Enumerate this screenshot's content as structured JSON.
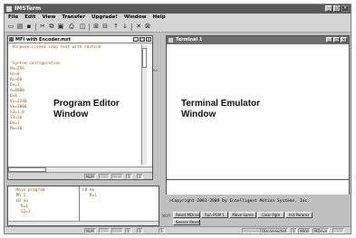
{
  "app": {
    "title": "IMSTerm"
  },
  "menu": [
    "File",
    "Edit",
    "View",
    "Transfer",
    "Upgrade!",
    "Window",
    "Help"
  ],
  "toolbar": {
    "icons": [
      "new-icon",
      "open-icon",
      "save-icon",
      "cut-icon",
      "copy-icon",
      "paste-icon",
      "print-icon",
      "properties-icon",
      "connect-icon",
      "disconnect-icon",
      "upload-icon",
      "download-icon",
      "close-x-icon"
    ]
  },
  "editor": {
    "title": "MFI with Encoder.mxt",
    "label": "Program Editor\nWindow",
    "code": "'Purpose:Closed loop test with routine\n\n\n'System configuration\nMs=256\nHc=0\nRc=60\nEe=1\nA=4000\nD=A\nVi=2240\nVm=3000\nS1=1,0\nS3=16\nDe=1\nMu=16",
    "status": [
      "NLM",
      "CAP",
      "NUM",
      "1",
      "1"
    ]
  },
  "immediate": {
    "left_code": "'Main program\n PR 1\n LB aa\n   R=1\n   S2=1",
    "right_code": "LB Hu\n   R=1"
  },
  "stray_text": "oo",
  "terminal": {
    "title": "Terminal 1",
    "label": "Terminal Emulator\nWindow",
    "copyright": ">Copyright 2001-2008 by Intelligent Motion Systems, Inc.",
    "nlm": "NLM",
    "buttons_row1": [
      "Reset MDrive",
      "Run PGM 1",
      "Move Some",
      "Clear Pgm",
      "Init Params"
    ],
    "buttons_row2": [
      "Seeere Reset"
    ]
  },
  "statusbar": {
    "fields": [
      "NLM",
      "CAP",
      "NUM",
      "1",
      "1",
      "1"
    ],
    "right_fields": [
      "Upgrade",
      "Disconnected",
      "1",
      "9600",
      "MDrive",
      "CAN"
    ]
  }
}
